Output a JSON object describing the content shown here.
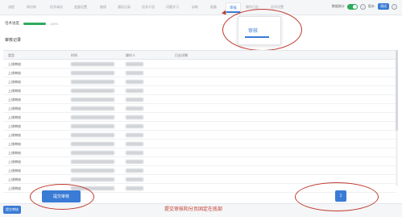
{
  "topnav": {
    "tabs": [
      "流程",
      "知识库",
      "话术调试",
      "变量设置",
      "路线",
      "通话记录",
      "话术介绍",
      "问题学习",
      "训练",
      "报备",
      "审核",
      "操作日志",
      "话术设置"
    ],
    "active_index": 10,
    "switch_label": "数据统计",
    "switch_on": true,
    "mode_label": "版本:",
    "mode_value": "测试"
  },
  "progress": {
    "label": "话术进度",
    "value": 1.0,
    "pct_text": "100%"
  },
  "callout": {
    "tab_label": "审核"
  },
  "section": {
    "title": "审核记录"
  },
  "table": {
    "headers": [
      "类型",
      "时间",
      "操作人",
      "日志详情"
    ],
    "rows": [
      {
        "type": "上线审核"
      },
      {
        "type": "上线审核"
      },
      {
        "type": "上线审核"
      },
      {
        "type": "上线审核"
      },
      {
        "type": "上线审核"
      },
      {
        "type": "上线审核"
      },
      {
        "type": "上线审核"
      },
      {
        "type": "上线审核"
      },
      {
        "type": "上线审核"
      },
      {
        "type": "上线审核"
      },
      {
        "type": "上线审核"
      },
      {
        "type": "上线审核"
      },
      {
        "type": "上线审核"
      },
      {
        "type": "上线审核"
      },
      {
        "type": "上线审核"
      }
    ]
  },
  "bottom": {
    "submit_label": "提交审核",
    "footer_button_label": "提交审核",
    "page_number": "1",
    "annotation": "提交审核和分页固定在底部"
  },
  "colors": {
    "accent": "#3a7bd5",
    "annotation": "#c0392b",
    "success": "#2eaa5c"
  }
}
